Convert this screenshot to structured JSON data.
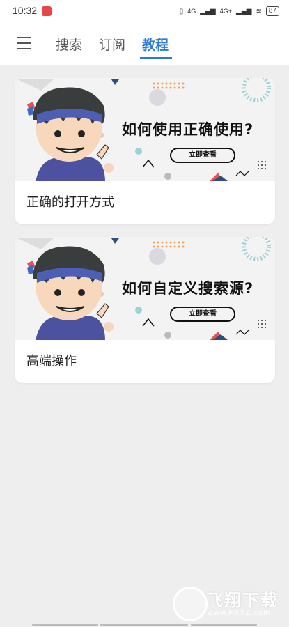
{
  "status_bar": {
    "time": "10:32",
    "network": "4G",
    "network2": "4G+",
    "battery": "87"
  },
  "tabs": [
    {
      "label": "搜索",
      "active": false
    },
    {
      "label": "订阅",
      "active": false
    },
    {
      "label": "教程",
      "active": true
    }
  ],
  "cards": [
    {
      "banner_title": "如何使用正确使用?",
      "banner_button": "立即查看",
      "caption": "正确的打开方式"
    },
    {
      "banner_title": "如何自定义搜索源?",
      "banner_button": "立即查看",
      "caption": "高端操作"
    }
  ],
  "watermark": {
    "text": "飞翔下载",
    "url": "www.FXXZ.com"
  },
  "colors": {
    "accent": "#2d7ad6",
    "background": "#eeeeee",
    "card": "#ffffff"
  }
}
